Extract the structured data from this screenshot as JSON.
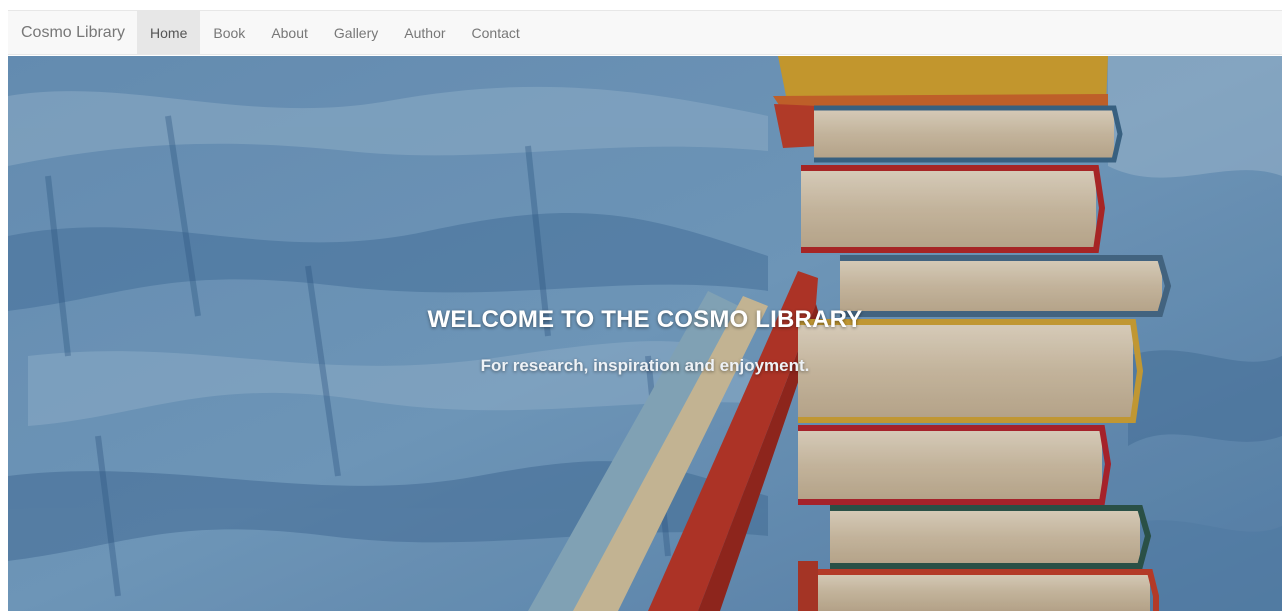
{
  "navbar": {
    "brand": "Cosmo Library",
    "items": [
      {
        "label": "Home",
        "active": true
      },
      {
        "label": "Book",
        "active": false
      },
      {
        "label": "About",
        "active": false
      },
      {
        "label": "Gallery",
        "active": false
      },
      {
        "label": "Author",
        "active": false
      },
      {
        "label": "Contact",
        "active": false
      }
    ]
  },
  "hero": {
    "title": "WELCOME TO THE COSMO LIBRARY",
    "subtitle": "For research, inspiration and enjoyment.",
    "image": "stack-of-books-on-blue-painted-wall"
  },
  "colors": {
    "navbar_bg": "#f8f8f8",
    "nav_active_bg": "#e7e7e7",
    "nav_text": "#777777",
    "hero_blue": "#5f8bb4",
    "hero_text": "#ffffff"
  }
}
